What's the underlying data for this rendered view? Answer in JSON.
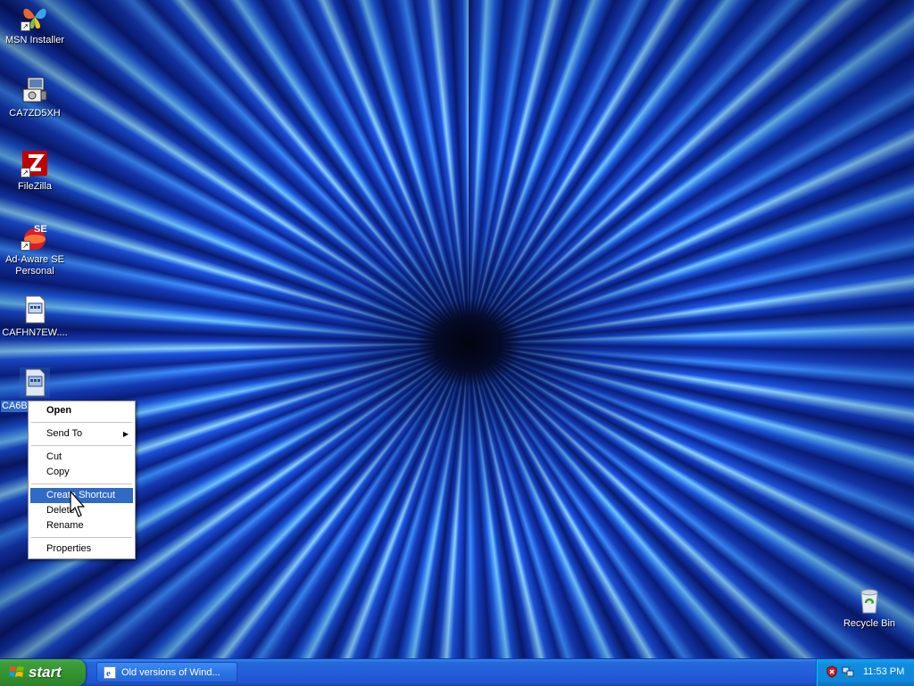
{
  "desktop_icons": [
    {
      "label": "MSN Installer",
      "icon": "msn-butterfly-icon"
    },
    {
      "label": "CA7ZD5XH",
      "icon": "setup-installer-icon"
    },
    {
      "label": "FileZilla",
      "icon": "filezilla-icon"
    },
    {
      "label": "Ad-Aware SE Personal",
      "icon": "ad-aware-icon"
    },
    {
      "label": "CAFHN7EW....",
      "icon": "system-file-icon"
    },
    {
      "label": "CA6BC",
      "icon": "system-file-icon",
      "selected": true
    },
    {
      "label": "Recycle Bin",
      "icon": "recycle-bin-icon"
    }
  ],
  "context_menu": {
    "items": [
      "Open",
      "Send To",
      "Cut",
      "Copy",
      "Create Shortcut",
      "Delete",
      "Rename",
      "Properties"
    ],
    "highlighted": "Create Shortcut"
  },
  "taskbar": {
    "start_label": "start",
    "tasks": [
      {
        "label": "Old versions of Wind...",
        "icon": "internet-explorer-icon"
      }
    ],
    "tray_icons": [
      "security-shield-icon",
      "network-icon"
    ],
    "clock": "11:53 PM"
  },
  "colors": {
    "selection": "#316ac5",
    "taskbar": "#245edb",
    "start_button": "#3b9e3a",
    "tray": "#0f8ce0"
  }
}
